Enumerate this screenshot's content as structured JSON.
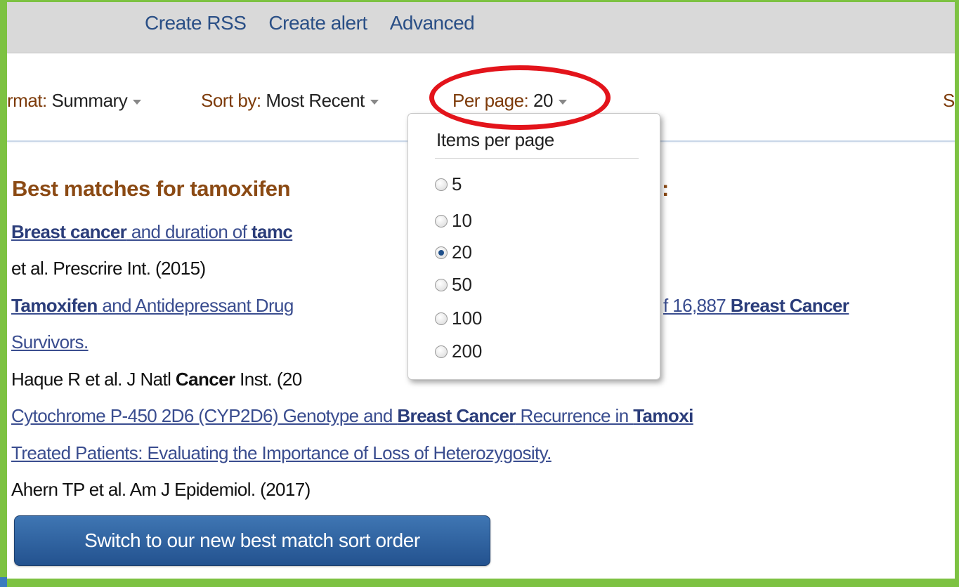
{
  "top_links": [
    "Create RSS",
    "Create alert",
    "Advanced"
  ],
  "display_settings": {
    "format_label": "rmat:",
    "format_value": "Summary",
    "sort_label": "Sort by:",
    "sort_value": "Most Recent",
    "perpage_label": "Per page:",
    "perpage_value": "20",
    "right_clip": "S"
  },
  "perpage_dropdown": {
    "title": "Items per page",
    "options": [
      "5",
      "10",
      "20",
      "50",
      "100",
      "200"
    ],
    "selected": "20"
  },
  "best_matches": {
    "heading": "Best matches for tamoxifen",
    "heading_colon": ":",
    "results": [
      {
        "title_parts": [
          {
            "text": "Breast cancer",
            "bold": true
          },
          {
            "text": " and duration of ",
            "bold": false
          },
          {
            "text": "tamc",
            "bold": true
          }
        ],
        "meta": "et al. Prescrire Int. (2015)"
      },
      {
        "title_line1_parts": [
          {
            "text": "Tamoxifen",
            "bold": true
          },
          {
            "text": " and Antidepressant Drug",
            "bold": false
          }
        ],
        "title_line1_tail_parts": [
          {
            "text": "f 16,887 ",
            "bold": false
          },
          {
            "text": "Breast Cancer",
            "bold": true
          }
        ],
        "title_line2": "Survivors.",
        "meta_parts": [
          {
            "text": "Haque R et al. J Natl ",
            "bold": false
          },
          {
            "text": "Cancer",
            "bold": true
          },
          {
            "text": " Inst. (20",
            "bold": false
          }
        ]
      },
      {
        "title_line1_parts": [
          {
            "text": "Cytochrome P-450 2D6 (CYP2D6) Genotype and ",
            "bold": false
          },
          {
            "text": "Breast Cancer",
            "bold": true
          },
          {
            "text": " Recurrence in ",
            "bold": false
          },
          {
            "text": "Tamoxi",
            "bold": true
          }
        ],
        "title_line2": "Treated Patients: Evaluating the Importance of Loss of Heterozygosity.",
        "meta": "Ahern TP et al. Am J Epidemiol. (2017)"
      }
    ]
  },
  "switch_button": "Switch to our new best match sort order",
  "colors": {
    "frame_green": "#7dc242",
    "highlight_red": "#e3141b",
    "button_blue": "#2f63a3",
    "heading_brown": "#8b4a14"
  }
}
